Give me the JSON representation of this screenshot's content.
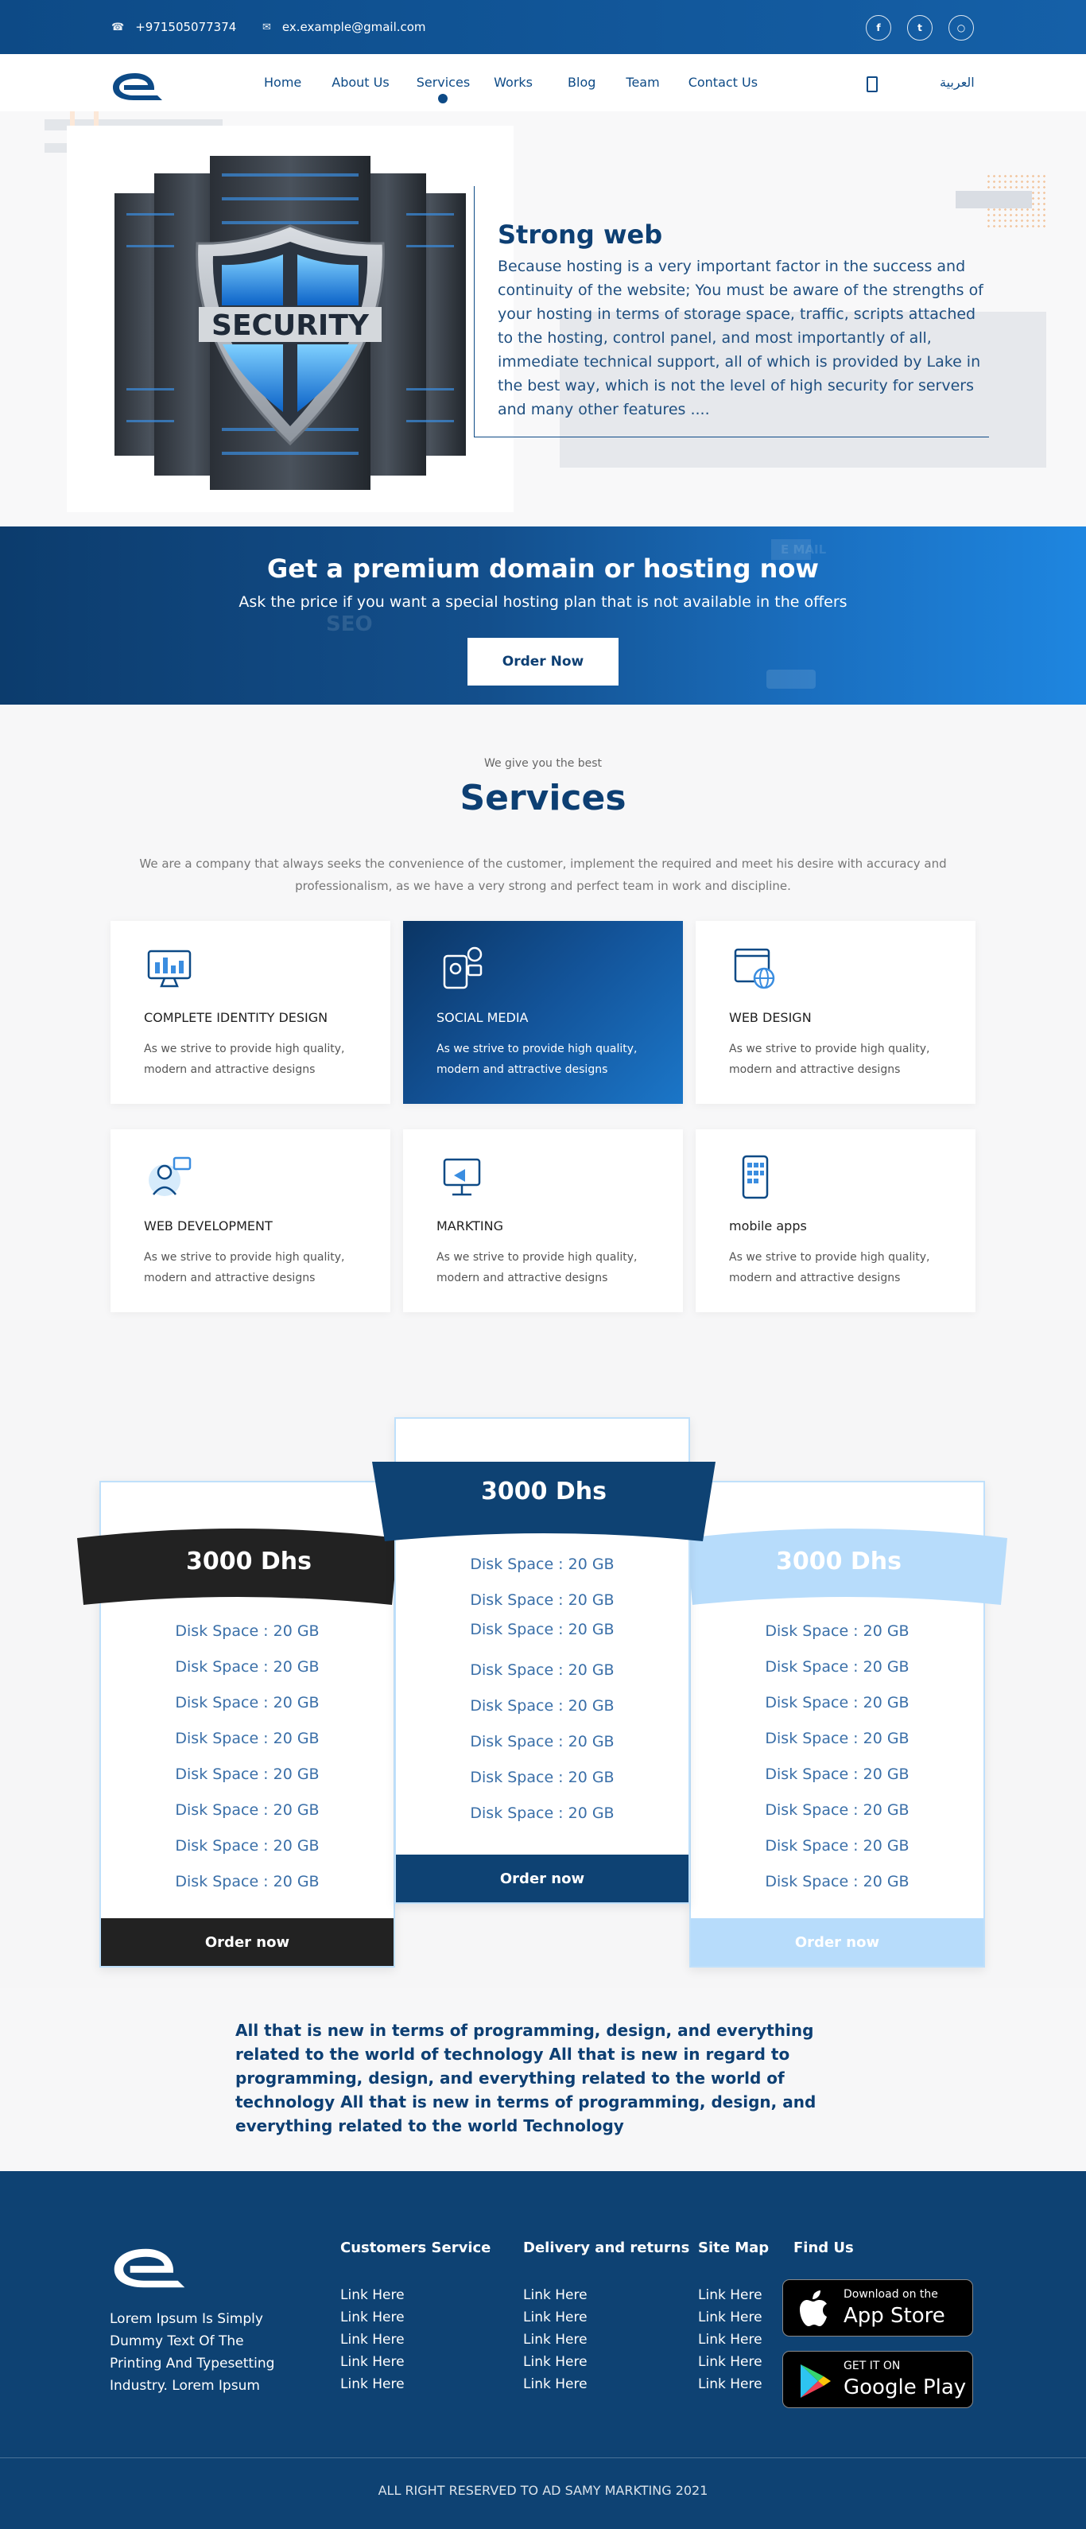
{
  "topbar": {
    "phone_icon": "phone-icon",
    "phone": "+971505077374",
    "email_icon": "mail-icon",
    "email": "ex.example@gmail.com",
    "social": [
      "facebook-icon",
      "twitter-icon",
      "instagram-icon"
    ]
  },
  "nav": {
    "items": [
      "Home",
      "About Us",
      "Services",
      "Works",
      "Blog",
      "Team",
      "Contact Us"
    ],
    "active": "Services",
    "language": "العربية"
  },
  "hero": {
    "title": "Strong web",
    "body": "Because hosting is a very important factor in the success and continuity of the website; You must be aware of the strengths of your hosting in terms of storage space, traffic, scripts attached to the hosting, control panel, and most importantly of all, immediate technical support, all of which is provided by Lake in the best way, which is not the level of high security for servers and many other features ....",
    "image_word": "SECURITY"
  },
  "banner": {
    "title": "Get a premium domain or hosting now",
    "subtitle": "Ask the price if you want a special hosting plan that is not available in the offers",
    "button": "Order Now",
    "bg_words": [
      "E MAIL",
      "SEO"
    ]
  },
  "services": {
    "kicker": "We give you the best",
    "title": "Services",
    "description": "We are a company that always seeks the convenience of the customer, implement the required and meet his desire with accuracy and professionalism, as we have a very strong and perfect team in work and discipline.",
    "cards": [
      {
        "title": "COMPLETE IDENTITY DESIGN",
        "desc": "As we strive to provide high quality, modern and attractive designs",
        "icon": "identity-design-icon"
      },
      {
        "title": "SOCIAL MEDIA",
        "desc": "As we strive to provide high quality, modern and attractive designs",
        "icon": "social-media-icon"
      },
      {
        "title": "WEB DESIGN",
        "desc": "As we strive to provide high quality, modern and attractive designs",
        "icon": "web-design-icon"
      },
      {
        "title": "WEB DEVELOPMENT",
        "desc": "As we strive to provide high quality, modern and attractive designs",
        "icon": "web-development-icon"
      },
      {
        "title": "MARKTING",
        "desc": "As we strive to provide high quality, modern and attractive designs",
        "icon": "marketing-icon"
      },
      {
        "title": "mobile apps",
        "desc": "As we strive to provide high quality, modern and attractive designs",
        "icon": "mobile-apps-icon"
      }
    ]
  },
  "pricing": {
    "plans": [
      {
        "price": "3000  Dhs",
        "feature": "Disk Space : 20 GB",
        "count": 8,
        "button": "Order now",
        "color": "#222222"
      },
      {
        "price": "3000  Dhs",
        "feature": "Disk Space : 20 GB",
        "count": 8,
        "button": "Order now",
        "color": "#0e4273"
      },
      {
        "price": "3000  Dhs",
        "feature": "Disk Space : 20 GB",
        "count": 8,
        "button": "Order now",
        "color": "#b7dcfb"
      }
    ]
  },
  "tagline": "All that is new in terms of programming, design, and everything related to the world of technology All that is new in regard to programming, design, and everything related to the world of technology All that is new in terms of programming, design, and everything related to the world Technology",
  "footer": {
    "about": "Lorem Ipsum Is Simply Dummy Text Of The Printing And Typesetting Industry. Lorem Ipsum",
    "columns": [
      {
        "title": "Customers Service",
        "links": [
          "Link Here",
          "Link Here",
          "Link Here",
          "Link Here",
          "Link Here"
        ]
      },
      {
        "title": "Delivery and returns",
        "links": [
          "Link Here",
          "Link Here",
          "Link Here",
          "Link Here",
          "Link Here"
        ]
      },
      {
        "title": "Site Map",
        "links": [
          "Link Here",
          "Link Here",
          "Link Here",
          "Link Here",
          "Link Here"
        ]
      }
    ],
    "find_us": "Find Us",
    "app_store": {
      "small": "Download on the",
      "big": "App Store"
    },
    "google_play": {
      "small": "GET IT ON",
      "big": "Google Play"
    },
    "copyright": "ALL RIGHT RESERVED TO AD SAMY MARKTING 2021"
  }
}
